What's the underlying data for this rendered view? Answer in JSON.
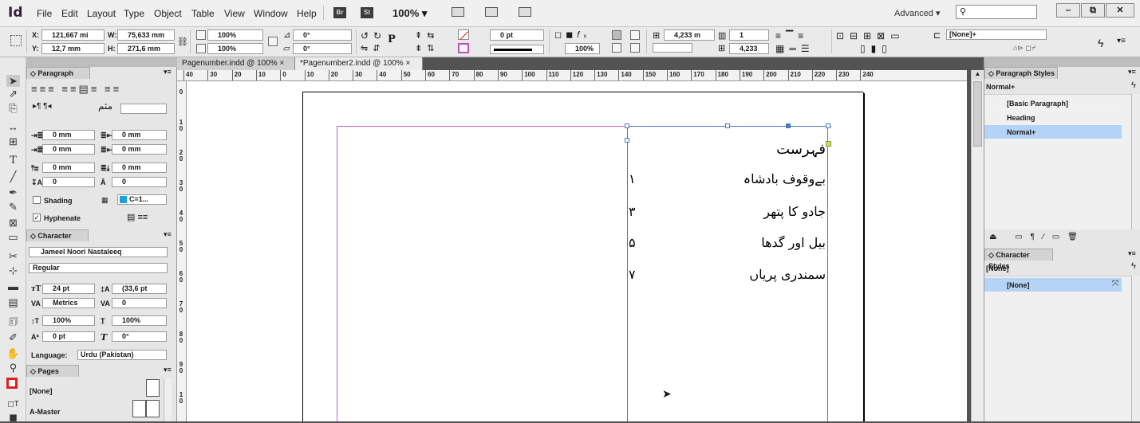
{
  "app": {
    "logo": "Id"
  },
  "menu": [
    "File",
    "Edit",
    "Layout",
    "Type",
    "Object",
    "Table",
    "View",
    "Window",
    "Help"
  ],
  "menubar_badges": [
    "Br",
    "St"
  ],
  "zoom": "100% ▾",
  "workspace": "Advanced ▾",
  "window_buttons": [
    "‒",
    "⧉",
    "✕"
  ],
  "control": {
    "x_label": "X:",
    "x_value": "121,667 mi",
    "y_label": "Y:",
    "y_value": "12,7 mm",
    "w_label": "W:",
    "w_value": "75,633 mm",
    "h_label": "H:",
    "h_value": "271,6 mm",
    "scale_x": "100%",
    "scale_y": "100%",
    "rotate": "0°",
    "shear": "0°",
    "stroke_weight": "0 pt",
    "opacity": "100%",
    "column_width": "4,233 m",
    "gutter": "4,233",
    "columns": "1",
    "object_style": "[None]+"
  },
  "doc_tabs": [
    "Pagenumber.indd @ 100% ×",
    "*Pagenumber2.indd @ 100% ×"
  ],
  "ruler_h": [
    "40",
    "30",
    "20",
    "10",
    "0",
    "10",
    "20",
    "30",
    "40",
    "50",
    "60",
    "70",
    "80",
    "90",
    "100",
    "110",
    "120",
    "130",
    "140",
    "150",
    "160",
    "170",
    "180",
    "190",
    "200",
    "210",
    "220",
    "230",
    "240"
  ],
  "ruler_v": [
    "0",
    "1 0",
    "2 0",
    "3 0",
    "4 0",
    "5 0",
    "6 0",
    "7 0",
    "8 0",
    "9 0",
    "1 0",
    "1 1"
  ],
  "paragraph_panel": {
    "title": "◇ Paragraph",
    "left_indent": "0 mm",
    "right_indent": "0 mm",
    "first_line": "0 mm",
    "last_line": "0 mm",
    "space_before": "0 mm",
    "space_after": "0 mm",
    "drop_lines": "0",
    "drop_chars": "0",
    "shading_label": "Shading",
    "shading_color": "C=1...",
    "hyphenate_label": "Hyphenate"
  },
  "character_panel": {
    "title": "◇ Character",
    "font": "Jameel Noori Nastaleeq",
    "style": "Regular",
    "size": "24 pt",
    "leading": "(33,6 pt",
    "kerning": "Metrics",
    "tracking": "0",
    "vscale": "100%",
    "hscale": "100%",
    "baseline": "0 pt",
    "skew": "0°",
    "language_label": "Language:",
    "language": "Urdu (Pakistan)"
  },
  "pages_panel": {
    "title": "◇ Pages",
    "items": [
      "[None]",
      "A-Master"
    ]
  },
  "document": {
    "toc_title": "فہرست",
    "entries": [
      {
        "title": "بےوقوف بادشاہ",
        "page": "۱"
      },
      {
        "title": "جادو کا پتھر",
        "page": "۳"
      },
      {
        "title": "بیل اور گدھا",
        "page": "۵"
      },
      {
        "title": "سمندری پریاں",
        "page": "۷"
      }
    ]
  },
  "paragraph_styles": {
    "title": "◇ Paragraph Styles",
    "current": "Normal+",
    "items": [
      "[Basic Paragraph]",
      "Heading",
      "Normal+"
    ],
    "selected_index": 2
  },
  "character_styles": {
    "title": "◇ Character Styles",
    "current": "[None]",
    "items": [
      "[None]"
    ]
  },
  "colors": {
    "selection": "#4a78c2",
    "margin": "#c061c4",
    "highlight": "#b4d3f5"
  }
}
